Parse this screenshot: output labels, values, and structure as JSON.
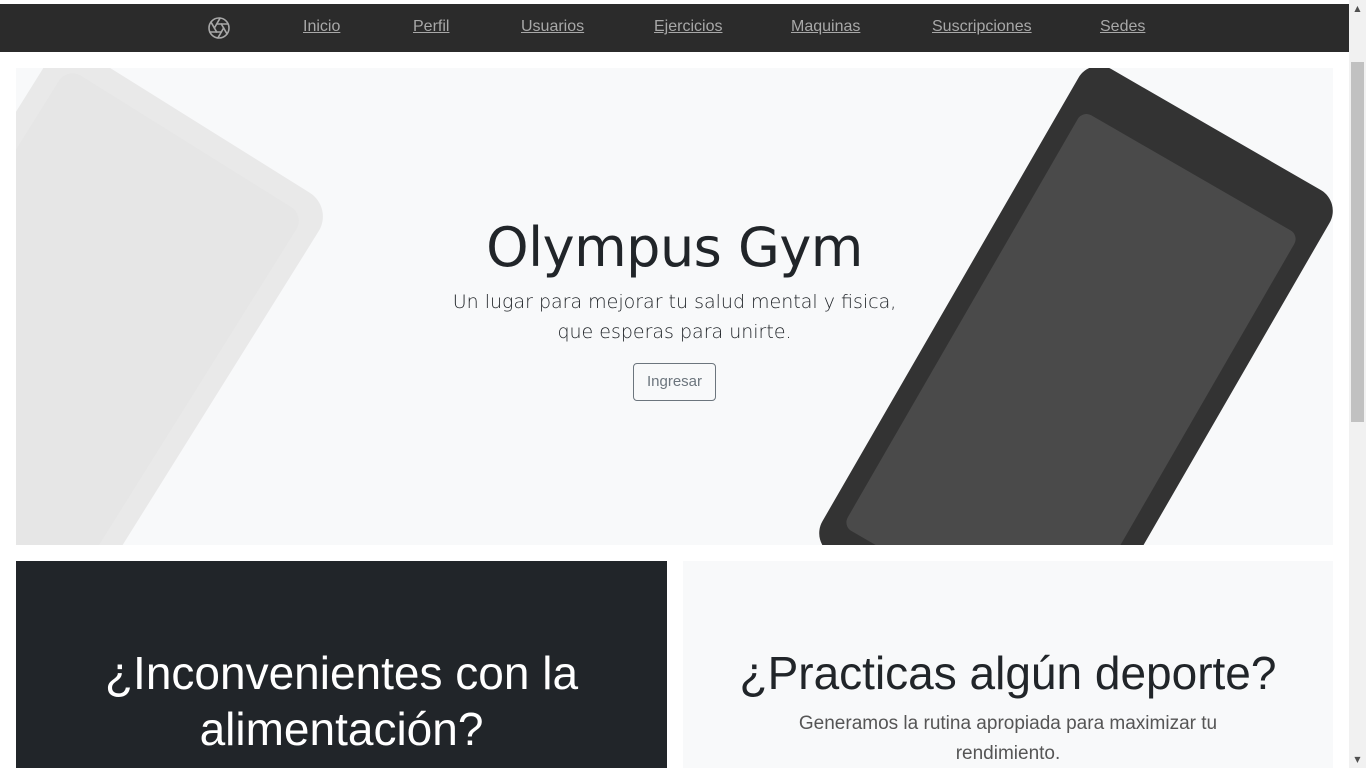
{
  "nav": {
    "logo_icon": "aperture-icon",
    "links": [
      "Inicio",
      "Perfil",
      "Usuarios",
      "Ejercicios",
      "Maquinas",
      "Suscripciones",
      "Sedes"
    ]
  },
  "hero": {
    "title": "Olympus Gym",
    "lead_line1": "Un lugar para mejorar tu salud mental y fisica,",
    "lead_line2": "que esperas para unirte.",
    "button": "Ingresar"
  },
  "cards": {
    "dark_title_line1": "¿Inconvenientes con la",
    "dark_title_line2": "alimentación?",
    "light_title": "¿Practicas algún deporte?",
    "light_text_line1": "Generamos la rutina apropiada para maximizar tu",
    "light_text_line2": "rendimiento."
  },
  "colors": {
    "navbar": "#2b2b2b",
    "hero_bg": "#f8f9fa",
    "dark_card": "#212529",
    "device_dark": "#333333"
  }
}
